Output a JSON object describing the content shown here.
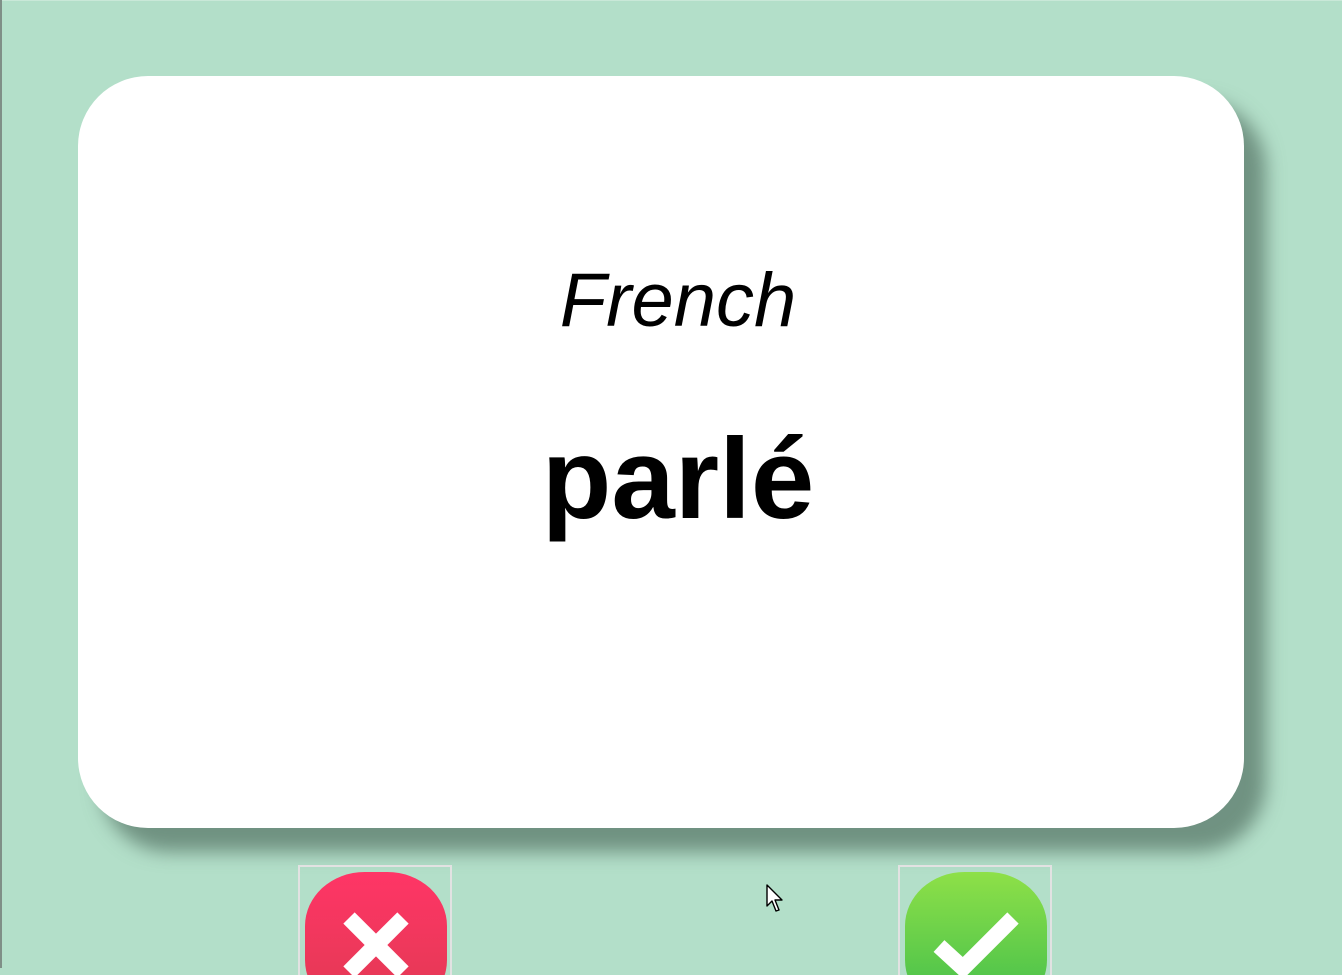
{
  "flashcard": {
    "language": "French",
    "word": "parlé"
  },
  "answer_buttons": {
    "wrong_icon": "x-icon",
    "right_icon": "checkmark-icon"
  },
  "colors": {
    "background": "#b3dfc9",
    "card": "#ffffff",
    "wrong_button": "#ff3566",
    "right_button": "#6fd34a"
  }
}
